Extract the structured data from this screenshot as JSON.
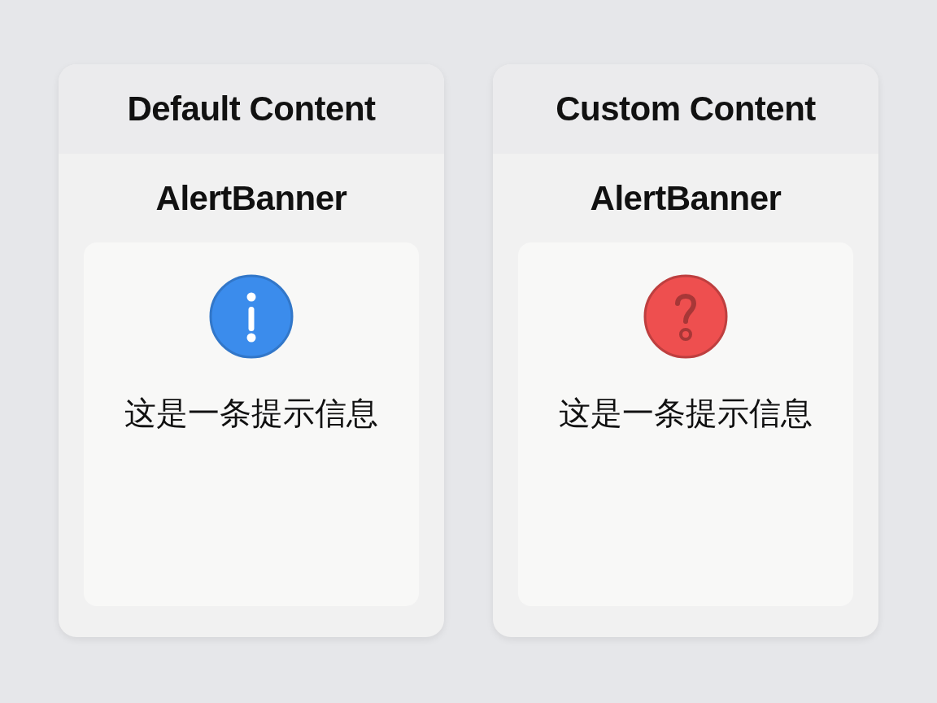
{
  "panels": [
    {
      "title": "Default Content",
      "component": "AlertBanner",
      "alert": {
        "kind": "info",
        "color": "#3b8cec",
        "message": "这是一条提示信息"
      }
    },
    {
      "title": "Custom Content",
      "component": "AlertBanner",
      "alert": {
        "kind": "question",
        "color": "#ee4f4f",
        "message": "这是一条提示信息"
      }
    }
  ]
}
